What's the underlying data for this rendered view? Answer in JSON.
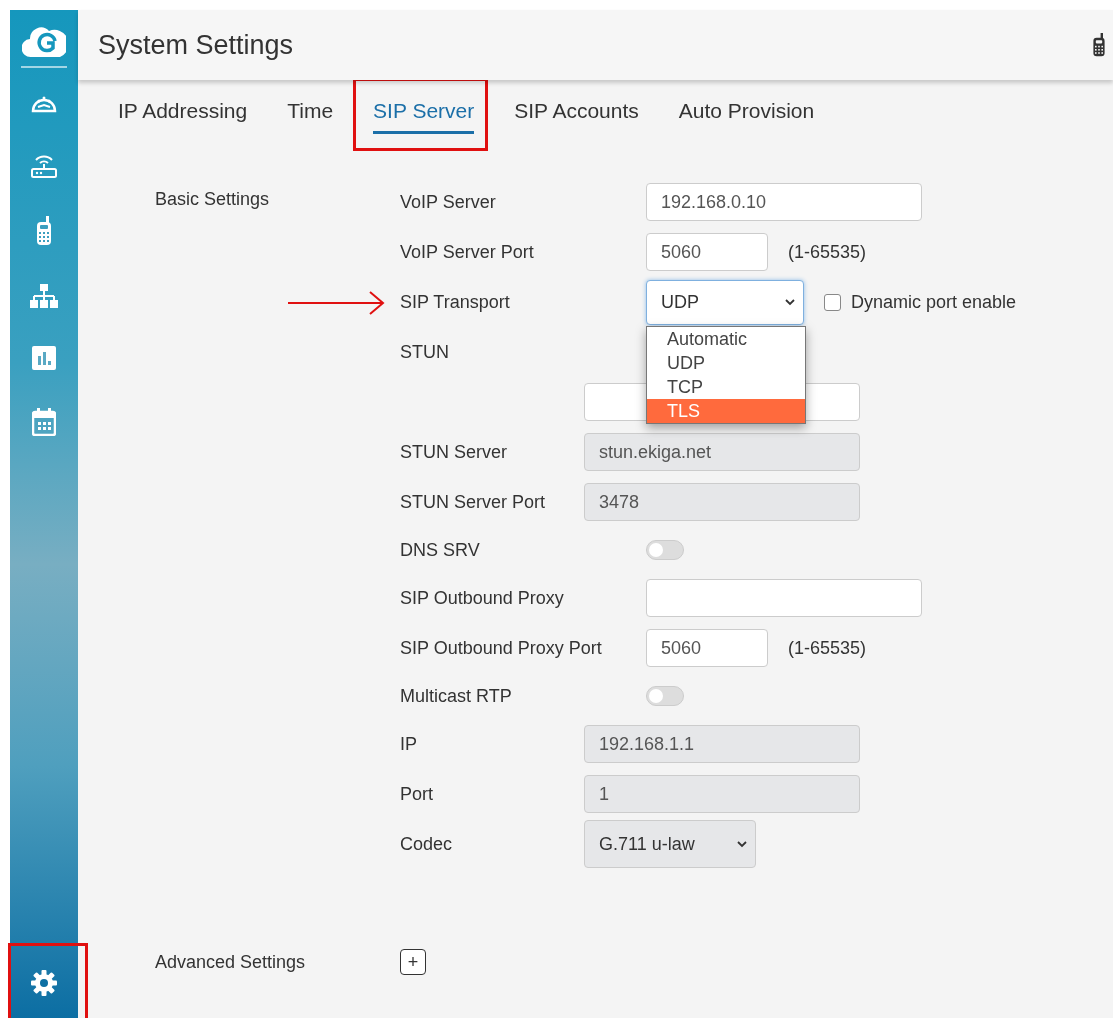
{
  "sidebar": {
    "settings_highlighted": true
  },
  "header": {
    "title": "System Settings"
  },
  "tabs": [
    {
      "label": "IP Addressing",
      "selected": false,
      "highlighted": false
    },
    {
      "label": "Time",
      "selected": false,
      "highlighted": false
    },
    {
      "label": "SIP Server",
      "selected": true,
      "highlighted": true
    },
    {
      "label": "SIP Accounts",
      "selected": false,
      "highlighted": false
    },
    {
      "label": "Auto Provision",
      "selected": false,
      "highlighted": false
    }
  ],
  "basic_settings": {
    "title": "Basic Settings",
    "fields": [
      {
        "kind": "input",
        "label": "VoIP Server",
        "value": "192.168.0.10"
      },
      {
        "kind": "port",
        "label": "VoIP Server Port",
        "value": "5060",
        "hint": "(1-65535)"
      },
      {
        "kind": "select",
        "label": "SIP Transport",
        "value": "UDP",
        "highlighted": true,
        "checkbox": {
          "label": "Dynamic port enable",
          "checked": false
        },
        "dropdown": {
          "open": true,
          "options": [
            {
              "label": "Automatic",
              "selected": false
            },
            {
              "label": "UDP",
              "selected": false
            },
            {
              "label": "TCP",
              "selected": false
            },
            {
              "label": "TLS",
              "selected": true
            }
          ]
        }
      },
      {
        "kind": "group",
        "label": "STUN",
        "children": [
          {
            "kind": "input",
            "disabled": false
          },
          {
            "kind": "input",
            "label": "STUN Server",
            "value": "stun.ekiga.net",
            "disabled": true
          },
          {
            "kind": "input",
            "label": "STUN Server Port",
            "value": "3478",
            "disabled": true
          }
        ]
      },
      {
        "kind": "toggle",
        "label": "DNS SRV",
        "on": false
      },
      {
        "kind": "input",
        "label": "SIP Outbound Proxy"
      },
      {
        "kind": "port",
        "label": "SIP Outbound Proxy Port",
        "value": "5060",
        "hint": "(1-65535)"
      },
      {
        "kind": "toggle",
        "label": "Multicast RTP",
        "on": false,
        "children": [
          {
            "kind": "input",
            "label": "IP",
            "value": "192.168.1.1",
            "disabled": true
          },
          {
            "kind": "input",
            "label": "Port",
            "value": "1",
            "disabled": true
          },
          {
            "kind": "select",
            "label": "Codec",
            "value": "G.711 u-law",
            "disabled": true
          }
        ]
      }
    ]
  },
  "advanced_settings": {
    "title": "Advanced Settings",
    "toggle": "+"
  }
}
